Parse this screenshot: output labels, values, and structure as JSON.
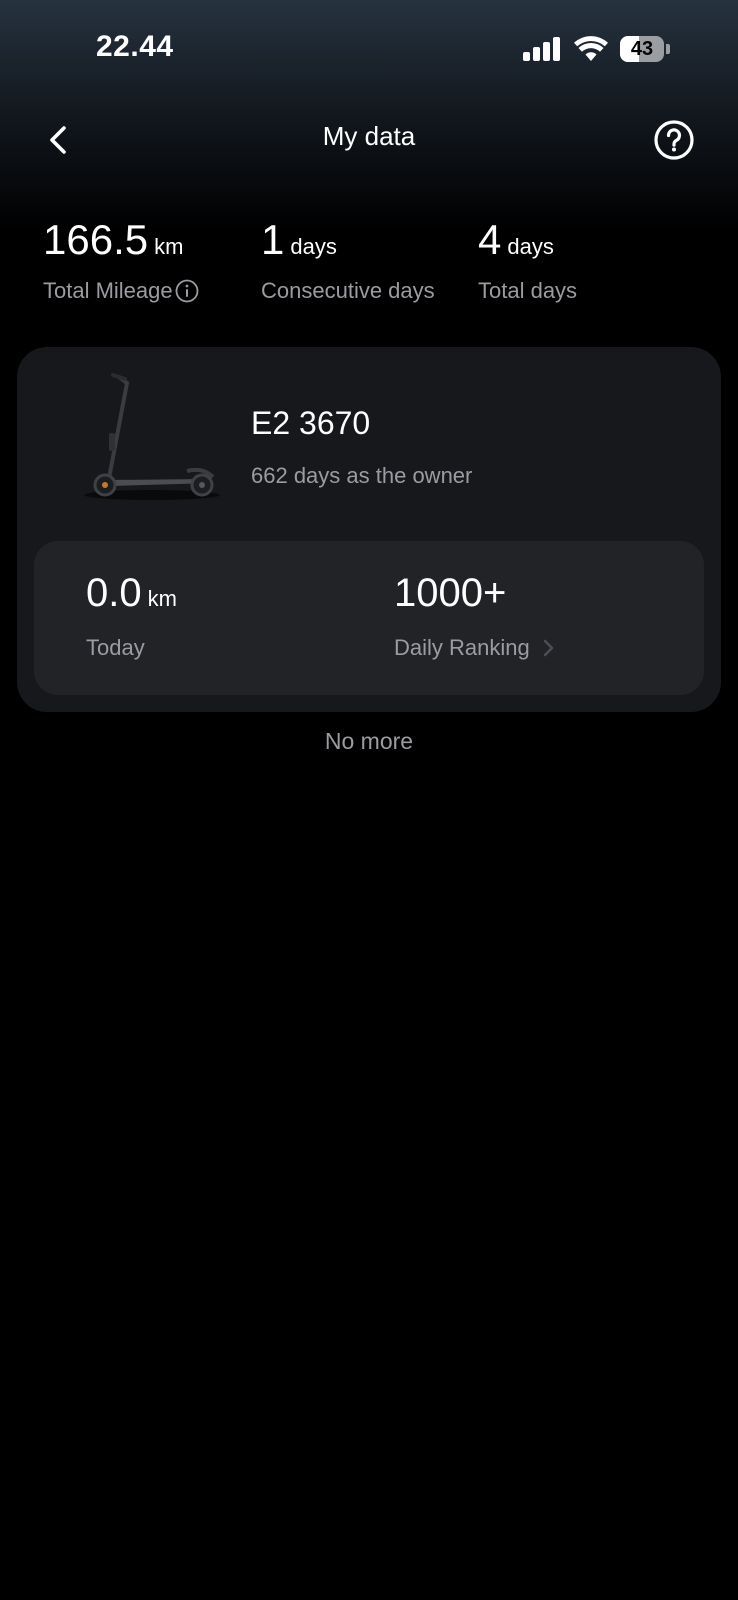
{
  "status_bar": {
    "time": "22.44",
    "battery": "43",
    "battery_level": 0.43
  },
  "nav": {
    "title": "My data"
  },
  "stats": [
    {
      "value": "166.5",
      "unit": "km",
      "label": "Total Mileage"
    },
    {
      "value": "1",
      "unit": "days",
      "label": "Consecutive days"
    },
    {
      "value": "4",
      "unit": "days",
      "label": "Total days"
    }
  ],
  "vehicle": {
    "model": "E2 3670",
    "owner_text": "662 days as the owner",
    "today_value": "0.0",
    "today_unit": "km",
    "today_label": "Today",
    "ranking_value": "1000+",
    "ranking_label": "Daily Ranking"
  },
  "footer": {
    "no_more": "No more"
  },
  "icons": {
    "back": "chevron-left-icon",
    "help": "question-circle-icon",
    "info": "info-circle-icon",
    "chevron": "chevron-right-icon"
  },
  "colors": {
    "background": "#000000",
    "card": "#17181b",
    "inner_card": "#222327",
    "secondary_text": "#9a9ca1"
  }
}
